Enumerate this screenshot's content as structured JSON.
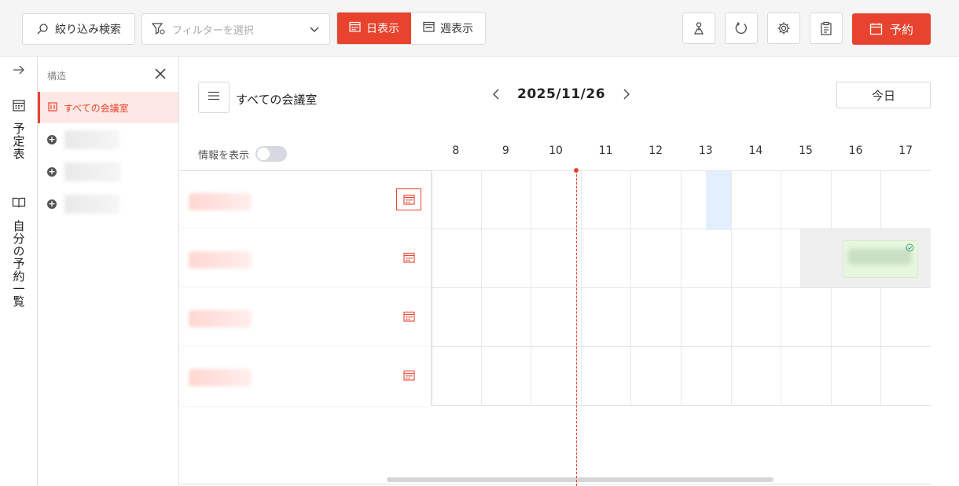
{
  "toolbar": {
    "search_label": "絞り込み検索",
    "filter_placeholder": "フィルターを選択",
    "view_day": "日表示",
    "view_week": "週表示",
    "reserve_label": "予約"
  },
  "nav": {
    "schedule": "予定表",
    "my_reservations": "自分の予約一覧"
  },
  "structure": {
    "heading": "構造",
    "selected": "すべての会議室",
    "items_count_hint": ""
  },
  "main": {
    "room_title": "すべての会議室",
    "date": "2025/11/26",
    "today_label": "今日",
    "info_label": "情報を表示",
    "hours": [
      "8",
      "9",
      "10",
      "11",
      "12",
      "13",
      "14",
      "15",
      "16",
      "17"
    ]
  },
  "colors": {
    "accent": "#e8432e",
    "highlight": "#e3efff",
    "event": "#e8f6df"
  }
}
